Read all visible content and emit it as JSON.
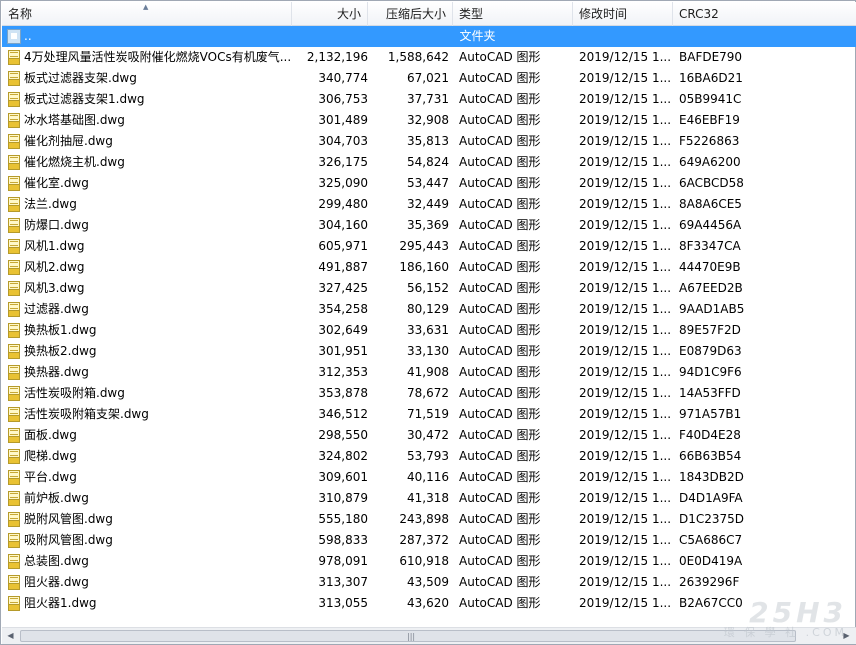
{
  "columns": {
    "name": "名称",
    "size": "大小",
    "packed": "压缩后大小",
    "type": "类型",
    "modified": "修改时间",
    "crc": "CRC32"
  },
  "parent_row": {
    "name": "..",
    "label": "文件夹"
  },
  "files": [
    {
      "name": "4万处理风量活性炭吸附催化燃烧VOCs有机废气...",
      "size": "2,132,196",
      "packed": "1,588,642",
      "type": "AutoCAD 图形",
      "modified": "2019/12/15 1...",
      "crc": "BAFDE790"
    },
    {
      "name": "板式过滤器支架.dwg",
      "size": "340,774",
      "packed": "67,021",
      "type": "AutoCAD 图形",
      "modified": "2019/12/15 1...",
      "crc": "16BA6D21"
    },
    {
      "name": "板式过滤器支架1.dwg",
      "size": "306,753",
      "packed": "37,731",
      "type": "AutoCAD 图形",
      "modified": "2019/12/15 1...",
      "crc": "05B9941C"
    },
    {
      "name": "冰水塔基础图.dwg",
      "size": "301,489",
      "packed": "32,908",
      "type": "AutoCAD 图形",
      "modified": "2019/12/15 1...",
      "crc": "E46EBF19"
    },
    {
      "name": "催化剂抽屉.dwg",
      "size": "304,703",
      "packed": "35,813",
      "type": "AutoCAD 图形",
      "modified": "2019/12/15 1...",
      "crc": "F5226863"
    },
    {
      "name": "催化燃烧主机.dwg",
      "size": "326,175",
      "packed": "54,824",
      "type": "AutoCAD 图形",
      "modified": "2019/12/15 1...",
      "crc": "649A6200"
    },
    {
      "name": "催化室.dwg",
      "size": "325,090",
      "packed": "53,447",
      "type": "AutoCAD 图形",
      "modified": "2019/12/15 1...",
      "crc": "6ACBCD58"
    },
    {
      "name": "法兰.dwg",
      "size": "299,480",
      "packed": "32,449",
      "type": "AutoCAD 图形",
      "modified": "2019/12/15 1...",
      "crc": "8A8A6CE5"
    },
    {
      "name": "防爆口.dwg",
      "size": "304,160",
      "packed": "35,369",
      "type": "AutoCAD 图形",
      "modified": "2019/12/15 1...",
      "crc": "69A4456A"
    },
    {
      "name": "风机1.dwg",
      "size": "605,971",
      "packed": "295,443",
      "type": "AutoCAD 图形",
      "modified": "2019/12/15 1...",
      "crc": "8F3347CA"
    },
    {
      "name": "风机2.dwg",
      "size": "491,887",
      "packed": "186,160",
      "type": "AutoCAD 图形",
      "modified": "2019/12/15 1...",
      "crc": "44470E9B"
    },
    {
      "name": "风机3.dwg",
      "size": "327,425",
      "packed": "56,152",
      "type": "AutoCAD 图形",
      "modified": "2019/12/15 1...",
      "crc": "A67EED2B"
    },
    {
      "name": "过滤器.dwg",
      "size": "354,258",
      "packed": "80,129",
      "type": "AutoCAD 图形",
      "modified": "2019/12/15 1...",
      "crc": "9AAD1AB5"
    },
    {
      "name": "换热板1.dwg",
      "size": "302,649",
      "packed": "33,631",
      "type": "AutoCAD 图形",
      "modified": "2019/12/15 1...",
      "crc": "89E57F2D"
    },
    {
      "name": "换热板2.dwg",
      "size": "301,951",
      "packed": "33,130",
      "type": "AutoCAD 图形",
      "modified": "2019/12/15 1...",
      "crc": "E0879D63"
    },
    {
      "name": "换热器.dwg",
      "size": "312,353",
      "packed": "41,908",
      "type": "AutoCAD 图形",
      "modified": "2019/12/15 1...",
      "crc": "94D1C9F6"
    },
    {
      "name": "活性炭吸附箱.dwg",
      "size": "353,878",
      "packed": "78,672",
      "type": "AutoCAD 图形",
      "modified": "2019/12/15 1...",
      "crc": "14A53FFD"
    },
    {
      "name": "活性炭吸附箱支架.dwg",
      "size": "346,512",
      "packed": "71,519",
      "type": "AutoCAD 图形",
      "modified": "2019/12/15 1...",
      "crc": "971A57B1"
    },
    {
      "name": "面板.dwg",
      "size": "298,550",
      "packed": "30,472",
      "type": "AutoCAD 图形",
      "modified": "2019/12/15 1...",
      "crc": "F40D4E28"
    },
    {
      "name": "爬梯.dwg",
      "size": "324,802",
      "packed": "53,793",
      "type": "AutoCAD 图形",
      "modified": "2019/12/15 1...",
      "crc": "66B63B54"
    },
    {
      "name": "平台.dwg",
      "size": "309,601",
      "packed": "40,116",
      "type": "AutoCAD 图形",
      "modified": "2019/12/15 1...",
      "crc": "1843DB2D"
    },
    {
      "name": "前炉板.dwg",
      "size": "310,879",
      "packed": "41,318",
      "type": "AutoCAD 图形",
      "modified": "2019/12/15 1...",
      "crc": "D4D1A9FA"
    },
    {
      "name": "脱附风管图.dwg",
      "size": "555,180",
      "packed": "243,898",
      "type": "AutoCAD 图形",
      "modified": "2019/12/15 1...",
      "crc": "D1C2375D"
    },
    {
      "name": "吸附风管图.dwg",
      "size": "598,833",
      "packed": "287,372",
      "type": "AutoCAD 图形",
      "modified": "2019/12/15 1...",
      "crc": "C5A686C7"
    },
    {
      "name": "总装图.dwg",
      "size": "978,091",
      "packed": "610,918",
      "type": "AutoCAD 图形",
      "modified": "2019/12/15 1...",
      "crc": "0E0D419A"
    },
    {
      "name": "阻火器.dwg",
      "size": "313,307",
      "packed": "43,509",
      "type": "AutoCAD 图形",
      "modified": "2019/12/15 1...",
      "crc": "2639296F"
    },
    {
      "name": "阻火器1.dwg",
      "size": "313,055",
      "packed": "43,620",
      "type": "AutoCAD 图形",
      "modified": "2019/12/15 1...",
      "crc": "B2A67CC0"
    }
  ],
  "watermark": {
    "big": "25H3",
    "small": "環 保 學 社 .COM"
  },
  "colors": {
    "selection": "#3399ff",
    "file_icon": "#e9c233"
  },
  "icons": {
    "sort": "sort-ascending-icon",
    "parent": "folder-up-icon",
    "file": "dwg-file-icon",
    "scroll_left": "scroll-left-arrow-icon",
    "scroll_right": "scroll-right-arrow-icon"
  }
}
